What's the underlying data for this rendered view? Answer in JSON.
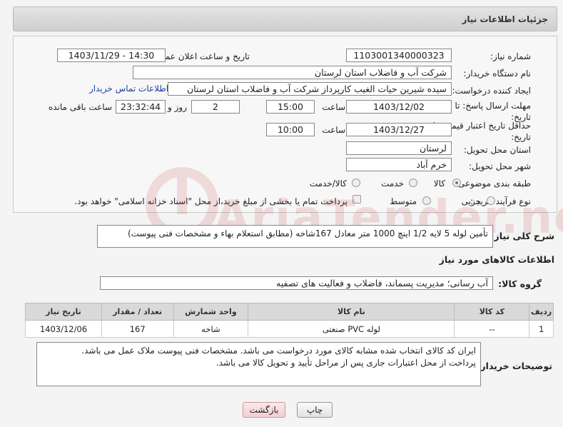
{
  "header": {
    "title": "جزئیات اطلاعات نیاز"
  },
  "form": {
    "need_number_label": "شماره نیاز:",
    "need_number": "1103001340000323",
    "announce_label": "تاریخ و ساعت اعلان عمومی:",
    "announce_value": "1403/11/29 - 14:30",
    "buyer_label": "نام دستگاه خریدار:",
    "buyer_value": "شرکت آب و فاضلاب استان لرستان",
    "creator_label": "ایجاد کننده درخواست:",
    "creator_value": "سیده شیرین حیات الغیب کارپرداز شرکت آب و فاضلاب استان لرستان",
    "contact_link": "اطلاعات تماس خریدار",
    "deadline_label": "مهلت ارسال پاسخ: تا تاریخ:",
    "deadline_date": "1403/12/02",
    "time_label": "ساعت",
    "deadline_time": "15:00",
    "days_value": "2",
    "days_label": "روز و",
    "remaining_time": "23:32:44",
    "remaining_label": "ساعت باقی مانده",
    "validity_label": "حداقل تاریخ اعتبار قیمت: تا تاریخ:",
    "validity_date": "1403/12/27",
    "validity_time": "10:00",
    "province_label": "استان محل تحویل:",
    "province_value": "لرستان",
    "city_label": "شهر محل تحویل:",
    "city_value": "خرم آباد",
    "category_label": "طبقه بندی موضوعی:",
    "category_options": [
      "کالا",
      "خدمت",
      "کالا/خدمت"
    ],
    "process_label": "نوع فرآیند خرید :",
    "process_options": [
      "جزیی",
      "متوسط"
    ],
    "payment_note": "پرداخت تمام یا بخشی از مبلغ خرید،از محل \"اسناد خزانه اسلامی\" خواهد بود."
  },
  "description": {
    "label": "شرح کلی نیاز:",
    "value": "تأمین لوله 5 لایه 1/2 اینچ 1000 متر معادل 167شاخه (مطابق استعلام بهاء و مشخصات فنی پیوست)"
  },
  "goods_info": {
    "title": "اطلاعات کالاهای مورد نیاز",
    "group_label": "گروه کالا:",
    "group_value": "آب رسانی؛ مدیریت پسماند، فاضلاب و فعالیت های تصفیه"
  },
  "table": {
    "headers": [
      "ردیف",
      "کد کالا",
      "نام کالا",
      "واحد شمارش",
      "تعداد / مقدار",
      "تاریخ نیاز"
    ],
    "rows": [
      [
        "1",
        "--",
        "لوله PVC صنعتی",
        "شاخه",
        "167",
        "1403/12/06"
      ]
    ]
  },
  "buyer_notes": {
    "label": "توضیحات خریدار:",
    "line1": "ایران کد کالای انتخاب شده مشابه کالای مورد درخواست می باشد. مشخصات فنی پیوست ملاک عمل می باشد.",
    "line2": "پرداخت از محل اعتبارات جاری پس از مراحل تأیید و تحویل کالا می باشد."
  },
  "buttons": {
    "print": "چاپ",
    "back": "بازگشت"
  },
  "watermark": "AriaTender.neT"
}
